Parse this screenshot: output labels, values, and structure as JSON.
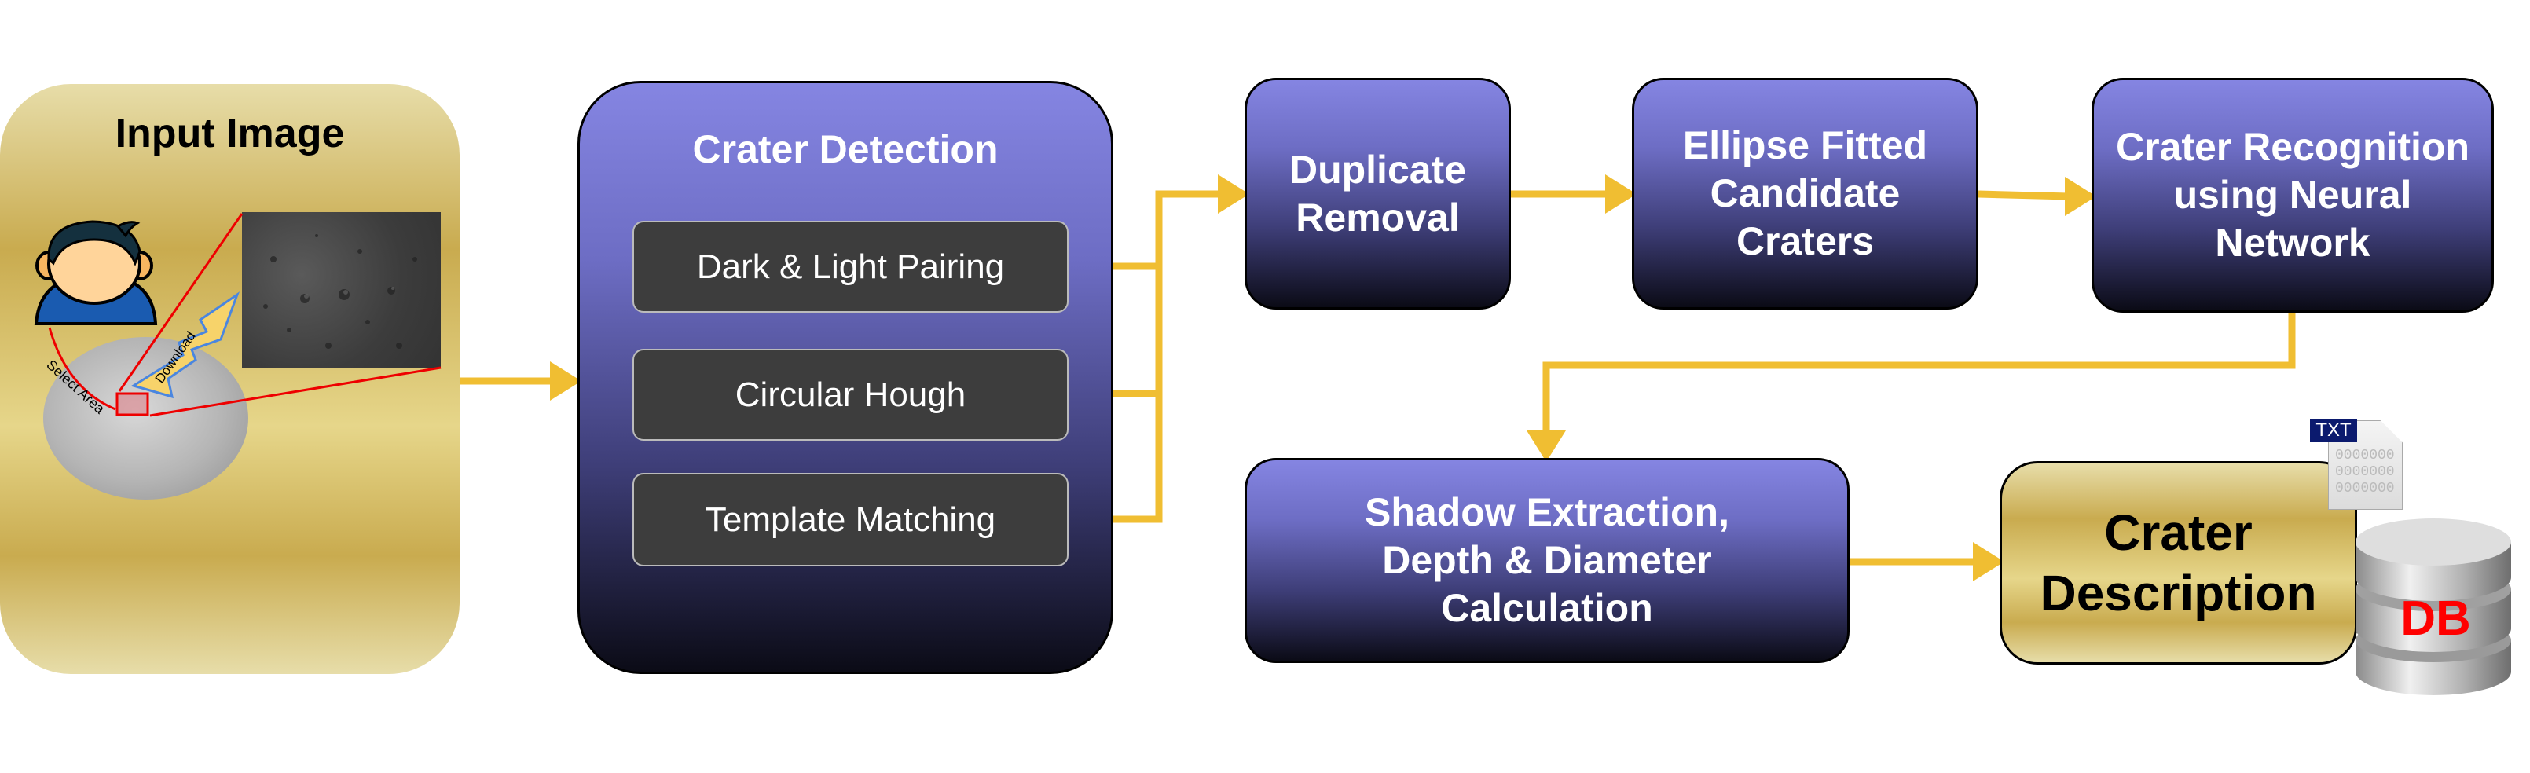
{
  "input_panel": {
    "title": "Input Image",
    "select_label": "Select Area",
    "download_label": "Download"
  },
  "detection": {
    "title": "Crater Detection",
    "methods": [
      "Dark & Light Pairing",
      "Circular Hough",
      "Template Matching"
    ]
  },
  "steps": {
    "duplicate": "Duplicate Removal",
    "ellipse": "Ellipse Fitted Candidate Craters",
    "recognition": "Crater Recognition using Neural Network",
    "shadow": "Shadow Extraction, Depth & Diameter Calculation",
    "description": "Crater Description"
  },
  "outputs": {
    "txt_label": "TXT",
    "txt_content": "0000000",
    "db_label": "DB"
  },
  "colors": {
    "arrow": "#F0BE32",
    "purple_top": "#8585E2",
    "gold": "#C9AB4F",
    "db_text": "#FF0000"
  }
}
